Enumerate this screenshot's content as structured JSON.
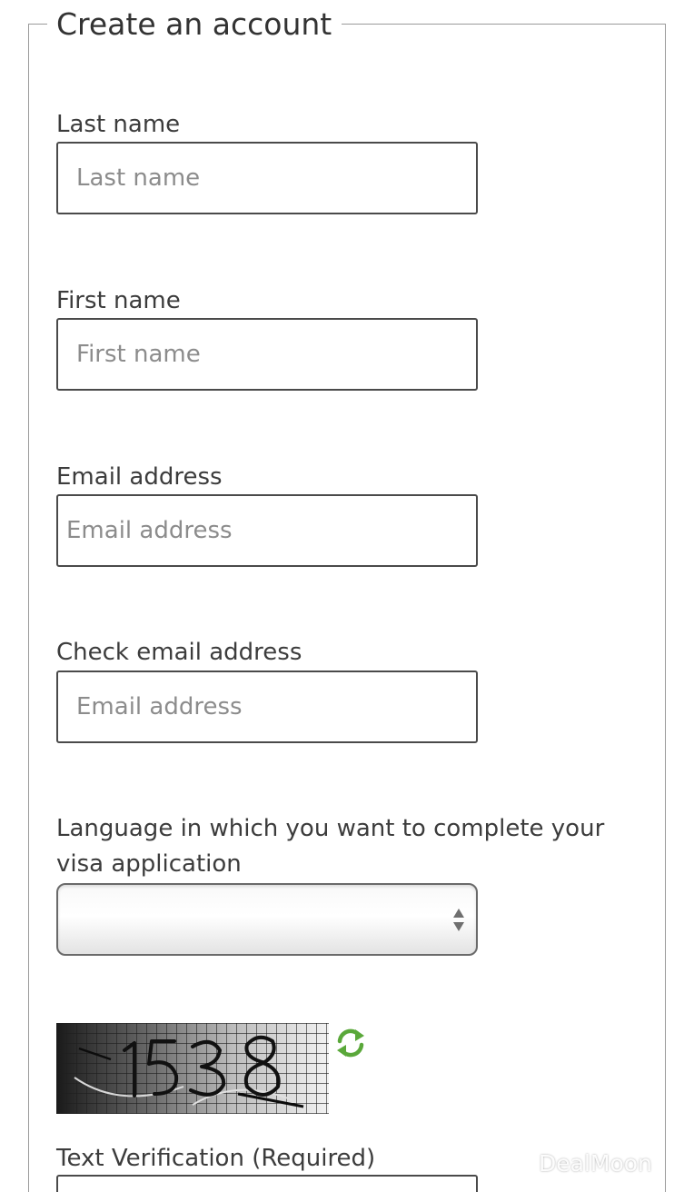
{
  "form": {
    "legend": "Create an account",
    "last_name": {
      "label": "Last name",
      "placeholder": "Last name"
    },
    "first_name": {
      "label": "First name",
      "placeholder": "First name"
    },
    "email": {
      "label": "Email address",
      "placeholder": "Email address"
    },
    "check_email": {
      "label": "Check email address",
      "placeholder": "Email address"
    },
    "language": {
      "label_line1": "Language in which you want to complete your",
      "label_line2": "visa application",
      "selected_value": ""
    },
    "captcha": {
      "digits": "1538",
      "refresh_icon": "refresh-icon"
    },
    "verification": {
      "label": "Text Verification (Required)",
      "value": ""
    }
  },
  "watermark": {
    "text": "DealMoon"
  },
  "colors": {
    "border": "#4a4a4a",
    "label_text": "#3c3c3c",
    "placeholder": "#8c8c8c",
    "refresh_green": "#5aa83a"
  }
}
